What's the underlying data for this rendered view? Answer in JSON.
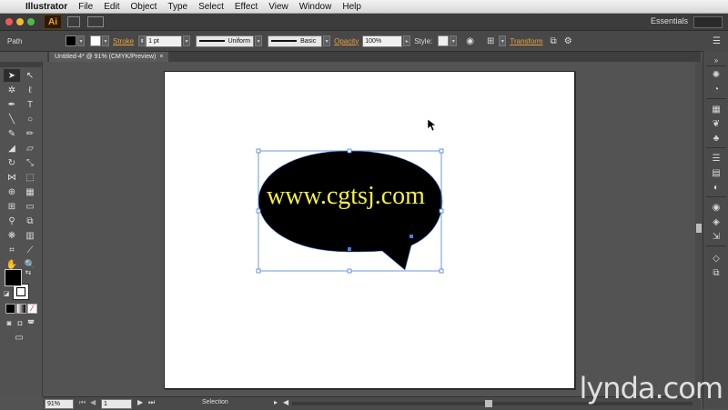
{
  "menubar": {
    "apple_icon": "apple-icon",
    "items": [
      "Illustrator",
      "File",
      "Edit",
      "Object",
      "Type",
      "Select",
      "Effect",
      "View",
      "Window",
      "Help"
    ]
  },
  "appbar": {
    "logo": "Ai",
    "workspace": "Essentials"
  },
  "control": {
    "selection_type": "Path",
    "stroke_label": "Stroke",
    "stroke_weight": "1 pt",
    "stroke_profile": "Uniform",
    "brush": "Basic",
    "opacity_label": "Opacity",
    "opacity_value": "100%",
    "style_label": "Style:",
    "transform_label": "Transform"
  },
  "document": {
    "tab_title": "Untitled-4* @ 91% (CMYK/Preview)",
    "tab_close": "×",
    "overlay_text": "www.cgtsj.com"
  },
  "status": {
    "zoom": "91%",
    "artboard_number": "1",
    "current_tool": "Selection"
  },
  "watermark": "lynda.com",
  "colors": {
    "accent_link": "#e8a040",
    "shape_fill": "#000000",
    "selection": "#4a7fd4",
    "overlay_text": "#f3f046"
  }
}
